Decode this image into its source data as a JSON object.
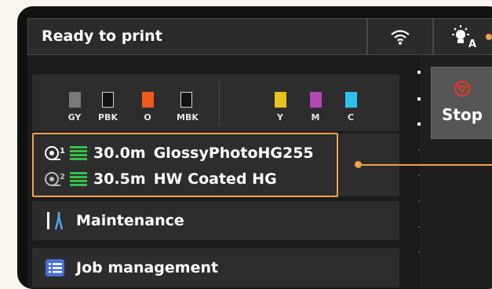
{
  "header": {
    "status": "Ready to print",
    "wifi_icon": "wifi-icon",
    "light_icon": "auto-light-icon"
  },
  "inks": [
    {
      "label": "GY",
      "color": "#7a7a7a"
    },
    {
      "label": "PBK",
      "color": "#111111"
    },
    {
      "label": "O",
      "color": "#f05a1e"
    },
    {
      "label": "MBK",
      "color": "#111111"
    },
    {
      "label": "Y",
      "color": "#e7c21f"
    },
    {
      "label": "M",
      "color": "#b247b8"
    },
    {
      "label": "C",
      "color": "#2ec0ef"
    }
  ],
  "media": [
    {
      "roll_number": "1",
      "length": "30.0m",
      "name": "GlossyPhotoHG255"
    },
    {
      "roll_number": "2",
      "length": "30.5m",
      "name": "HW Coated HG"
    }
  ],
  "menu": {
    "maintenance": "Maintenance",
    "job_management": "Job management"
  },
  "stop": {
    "label": "Stop"
  },
  "colors": {
    "accent": "#f0a24c",
    "level_green": "#37c24a",
    "stop_red": "#e03a2a"
  }
}
